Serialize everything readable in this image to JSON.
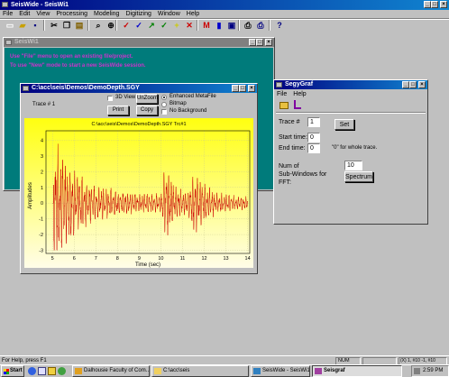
{
  "main_window": {
    "title": "SeisWide - SeisWi1",
    "menu": [
      "File",
      "Edit",
      "View",
      "Processing",
      "Modeling",
      "Digitizing",
      "Window",
      "Help"
    ],
    "toolbar": [
      {
        "icon": "new-icon",
        "glyph": "▭",
        "color": "#ffffff"
      },
      {
        "icon": "open-icon",
        "glyph": "▰",
        "color": "#c8a000"
      },
      {
        "icon": "save-icon",
        "glyph": "▪",
        "color": "#000080"
      },
      {
        "icon": "cut-icon",
        "glyph": "✂",
        "color": "#000000"
      },
      {
        "icon": "copy-icon",
        "glyph": "❐",
        "color": "#000000"
      },
      {
        "icon": "paste-icon",
        "glyph": "▤",
        "color": "#806000"
      },
      {
        "icon": "zoom-icon",
        "glyph": "⌕",
        "color": "#000000"
      },
      {
        "icon": "zoom-in-icon",
        "glyph": "⊕",
        "color": "#000000"
      },
      {
        "icon": "check-red-icon",
        "glyph": "✓",
        "color": "#cc0000"
      },
      {
        "icon": "check-blue-icon",
        "glyph": "✓",
        "color": "#0000cc"
      },
      {
        "icon": "arrow-icon",
        "glyph": "↗",
        "color": "#008000"
      },
      {
        "icon": "check-green-icon",
        "glyph": "✓",
        "color": "#008000"
      },
      {
        "icon": "plus-icon",
        "glyph": "+",
        "color": "#cccc00"
      },
      {
        "icon": "cross-icon",
        "glyph": "✕",
        "color": "#cc0000"
      },
      {
        "icon": "m-icon",
        "glyph": "M",
        "color": "#cc0000"
      },
      {
        "icon": "color-bar-icon",
        "glyph": "▮",
        "color": "#0000cc"
      },
      {
        "icon": "floppy-icon",
        "glyph": "▣",
        "color": "#000080"
      },
      {
        "icon": "print-icon",
        "glyph": "⎙",
        "color": "#000000"
      },
      {
        "icon": "print-preview-icon",
        "glyph": "⎙",
        "color": "#000080"
      },
      {
        "icon": "help-icon",
        "glyph": "?",
        "color": "#000080"
      }
    ],
    "status_text": "For Help, press F1",
    "status_panes": [
      "NUM",
      "",
      "(X) 1, #10  -1, #10"
    ]
  },
  "seiswi_window": {
    "title": "SeisWi1",
    "messages": [
      "Use \"File\" menu to open an existing file/project.",
      "To use \"New\" mode to start a new SeisWide session."
    ],
    "message_color": "#cc33cc",
    "bg_color": "#007b7b"
  },
  "trace_window": {
    "title": "C:\\acc\\seis\\Demos\\DemoDepth.SGY",
    "trace_label": "Trace #  1",
    "view_3d_label": "3D View",
    "unzoom_label": "UnZoom",
    "print_label": "Print",
    "copy_label": "Copy",
    "radio_options": [
      {
        "label": "Enhanced MetaFile",
        "selected": true
      },
      {
        "label": "Bitmap",
        "selected": false
      }
    ],
    "no_background_label": "No Background",
    "plot_title": "C:\\acc\\seis\\Demos\\DemoDepth.SGY Trc#1"
  },
  "segygraf_window": {
    "title": "SegyGraf",
    "menu": [
      "File",
      "Help"
    ],
    "trace_label": "Trace #",
    "trace_value": "1",
    "set_label": "Set",
    "start_label": "Start time:",
    "start_value": "0",
    "end_label": "End time:",
    "end_value": "0",
    "end_hint": "\"0\" for whole trace.",
    "num_label_1": "Num of",
    "num_label_2": "Sub-Windows for",
    "num_label_3": "FFT:",
    "num_value": "10",
    "spectrum_label": "Spectrum"
  },
  "taskbar": {
    "start_label": "Start",
    "tasks": [
      {
        "label": "Dalhousie Faculty of Com...",
        "active": false
      },
      {
        "label": "C:\\acc\\seis",
        "active": false
      },
      {
        "label": "SeisWide - SeisWi1",
        "active": false
      },
      {
        "label": "Seisgraf",
        "active": true
      }
    ],
    "clock": "2:59 PM"
  },
  "chart_data": {
    "type": "line",
    "title": "C:\\acc\\seis\\Demos\\DemoDepth.SGY Trc#1",
    "xlabel": "Time (sec)",
    "ylabel": "Amplitudes",
    "xlim": [
      4.7,
      14.1
    ],
    "ylim": [
      -3.2,
      4.6
    ],
    "xticks": [
      "5",
      "6",
      "7",
      "8",
      "9",
      "10",
      "11",
      "12",
      "13",
      "14"
    ],
    "yticks": [
      "4",
      "3",
      "2",
      "1",
      "0",
      "-1",
      "-2",
      "-3"
    ],
    "line_color": "#cc0000",
    "background_gradient": [
      "#ffff20",
      "#fffde0"
    ],
    "grid": true,
    "envelope": [
      {
        "t": 5.0,
        "a": 0.05
      },
      {
        "t": 5.05,
        "a": 4.0
      },
      {
        "t": 5.3,
        "a": 3.6
      },
      {
        "t": 5.6,
        "a": 2.8
      },
      {
        "t": 6.0,
        "a": 2.0
      },
      {
        "t": 6.5,
        "a": 1.5
      },
      {
        "t": 7.0,
        "a": 1.1
      },
      {
        "t": 8.0,
        "a": 0.8
      },
      {
        "t": 9.0,
        "a": 0.6
      },
      {
        "t": 10.0,
        "a": 0.6
      },
      {
        "t": 10.2,
        "a": 2.3
      },
      {
        "t": 10.6,
        "a": 1.2
      },
      {
        "t": 11.0,
        "a": 0.7
      },
      {
        "t": 11.3,
        "a": 0.9
      },
      {
        "t": 11.5,
        "a": 2.0
      },
      {
        "t": 11.9,
        "a": 1.3
      },
      {
        "t": 12.5,
        "a": 0.7
      },
      {
        "t": 13.2,
        "a": 0.5
      },
      {
        "t": 14.0,
        "a": 0.4
      }
    ]
  }
}
